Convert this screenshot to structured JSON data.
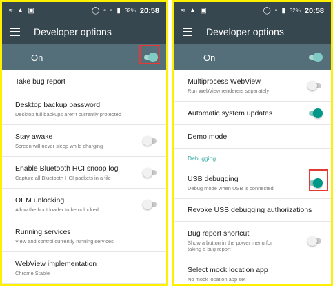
{
  "statusbar": {
    "left": {
      "time": "20:58",
      "battery": "32%"
    },
    "right": {
      "time": "20:58",
      "battery": "32%"
    }
  },
  "toolbar": {
    "title": "Developer options"
  },
  "master": {
    "label": "On",
    "state": "on"
  },
  "left_items": [
    {
      "title": "Take bug report",
      "subtitle": ""
    },
    {
      "title": "Desktop backup password",
      "subtitle": "Desktop full backups aren't currently protected"
    },
    {
      "title": "Stay awake",
      "subtitle": "Screen will never sleep while charging",
      "switch": "off"
    },
    {
      "title": "Enable Bluetooth HCI snoop log",
      "subtitle": "Capture all Bluetooth HCI packets in a file",
      "switch": "off"
    },
    {
      "title": "OEM unlocking",
      "subtitle": "Allow the boot loader to be unlocked",
      "switch": "off"
    },
    {
      "title": "Running services",
      "subtitle": "View and control currently running services"
    },
    {
      "title": "WebView implementation",
      "subtitle": "Chrome Stable"
    }
  ],
  "right_items": [
    {
      "title": "Multiprocess WebView",
      "subtitle": "Run WebView renderers separately",
      "switch": "off"
    },
    {
      "title": "Automatic system updates",
      "subtitle": "",
      "switch": "on"
    },
    {
      "title": "Demo mode",
      "subtitle": ""
    },
    {
      "category": "Debugging"
    },
    {
      "title": "USB debugging",
      "subtitle": "Debug mode when USB is connected",
      "switch": "on"
    },
    {
      "title": "Revoke USB debugging authorizations",
      "subtitle": ""
    },
    {
      "title": "Bug report shortcut",
      "subtitle": "Show a button in the power menu for taking a bug report",
      "switch": "off"
    },
    {
      "title": "Select mock location app",
      "subtitle": "No mock location app set"
    }
  ],
  "colors": {
    "frame_highlight": "#ffef00",
    "annotation": "#e53935",
    "accent": "#009688",
    "toolbar": "#37474f",
    "master_bar": "#546e7a"
  },
  "icons": {
    "statusbar_left": [
      "wifi-icon",
      "warning-icon",
      "image-icon"
    ],
    "statusbar_right": [
      "alarm-icon",
      "signal-icon",
      "signal-icon",
      "battery-icon"
    ],
    "toolbar": "menu-icon"
  }
}
